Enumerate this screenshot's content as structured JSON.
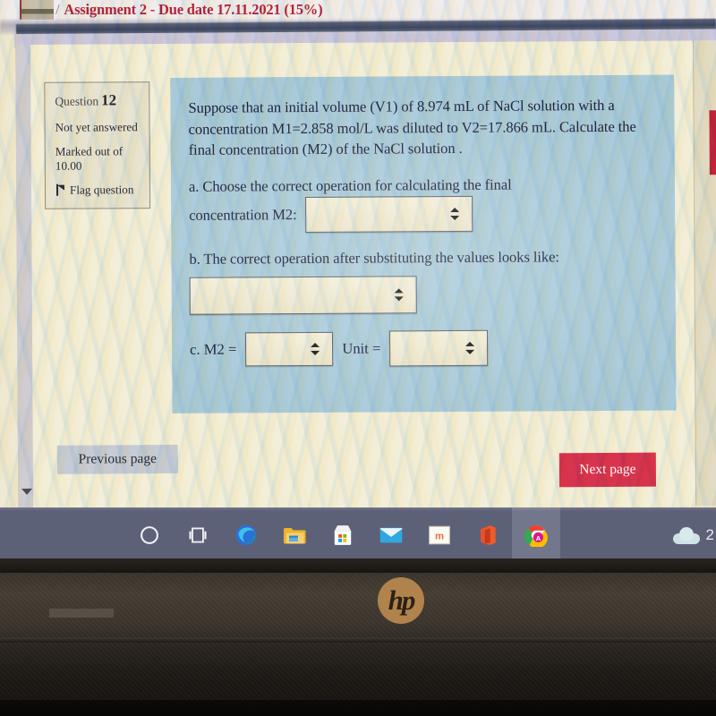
{
  "breadcrumb": {
    "separator": "/",
    "text": "Assignment 2 - Due date 17.11.2021 (15%)"
  },
  "question_info": {
    "label": "Question",
    "number": "12",
    "state": "Not yet answered",
    "marks": "Marked out of 10.00",
    "flag_label": "Flag question",
    "flag_icon": "flag-icon"
  },
  "question": {
    "stem": "Suppose that an initial volume (V1) of 8.974 mL of NaCl solution with a concentration M1=2.858 mol/L was diluted to V2=17.866 mL. Calculate the final concentration (M2) of the NaCl solution .",
    "part_a": {
      "prefix": "a. Choose the correct operation for calculating the final",
      "label": "concentration M2:",
      "select_value": "",
      "select_icon": "updown-arrows-icon"
    },
    "part_b": {
      "label": "b. The correct operation after substituting the values looks like:",
      "select_value": "",
      "select_icon": "updown-arrows-icon"
    },
    "part_c": {
      "prefix": "c.  M2 =",
      "m2_select_value": "",
      "unit_label": "Unit =",
      "unit_select_value": "",
      "select_icon": "updown-arrows-icon"
    }
  },
  "navigation": {
    "previous_label": "Previous page",
    "next_label": "Next page",
    "scroll_caret_icon": "caret-down-icon"
  },
  "taskbar": {
    "items": [
      {
        "name": "cortana-icon",
        "label": "Cortana"
      },
      {
        "name": "task-view-icon",
        "label": "Task View"
      },
      {
        "name": "edge-icon",
        "label": "Microsoft Edge"
      },
      {
        "name": "file-explorer-icon",
        "label": "File Explorer"
      },
      {
        "name": "microsoft-store-icon",
        "label": "Microsoft Store"
      },
      {
        "name": "mail-icon",
        "label": "Mail"
      },
      {
        "name": "moodle-icon",
        "label": "Moodle"
      },
      {
        "name": "office-icon",
        "label": "Office"
      },
      {
        "name": "chrome-icon",
        "label": "Google Chrome"
      }
    ],
    "weather": {
      "icon": "cloud-icon",
      "temperature": "2"
    }
  },
  "device": {
    "brand": "hp",
    "sticker": ""
  },
  "colors": {
    "accent_red": "#b3253c",
    "next_button": "#d8344f",
    "question_panel": "#a9cada",
    "page_background": "#f3eed8",
    "info_panel": "#e7e3d0",
    "taskbar": "#5d6178",
    "select_fill": "#f2eeda"
  }
}
